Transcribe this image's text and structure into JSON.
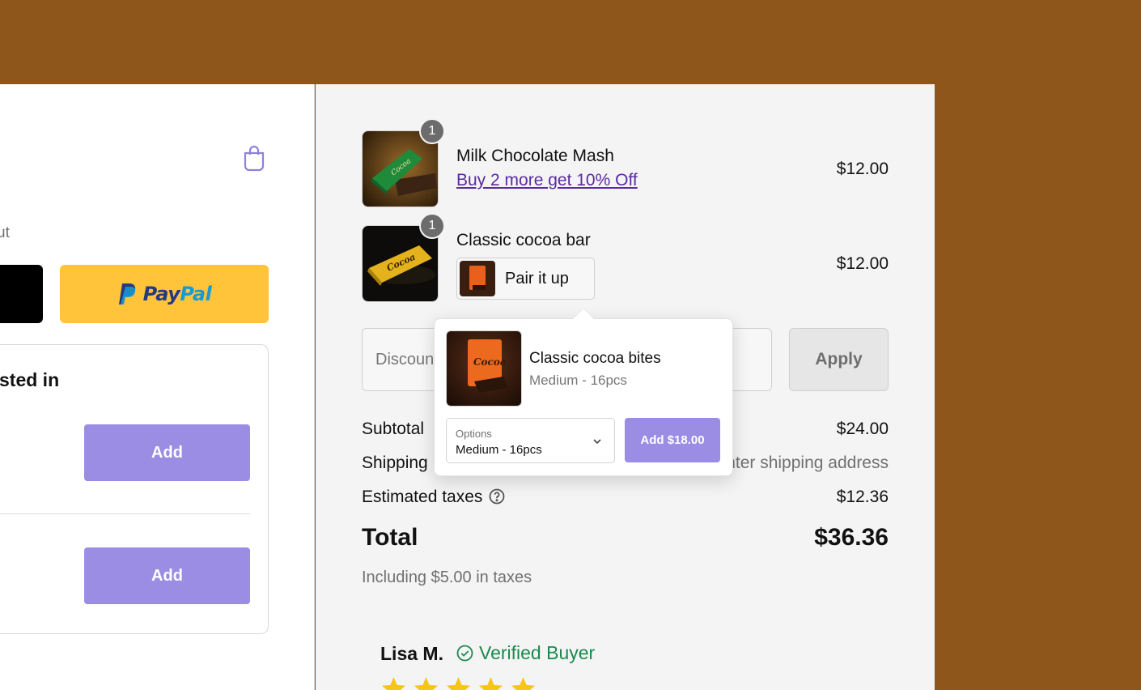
{
  "left": {
    "express_checkout_label": "ut",
    "paypal_label_pay": "Pay",
    "paypal_label_pal": "Pal",
    "upsell_heading": "sted in",
    "add_label_1": "Add",
    "add_label_2": "Add"
  },
  "cart": {
    "items": [
      {
        "name": "Milk Chocolate Mash",
        "price": "$12.00",
        "quantity": "1",
        "promo": "Buy 2 more get 10% Off"
      },
      {
        "name": "Classic cocoa bar",
        "price": "$12.00",
        "quantity": "1",
        "pair_label": "Pair it up"
      }
    ]
  },
  "discount": {
    "placeholder": "Discount code or gift card",
    "apply_label": "Apply"
  },
  "summary": {
    "subtotal_label": "Subtotal",
    "subtotal_value": "$24.00",
    "shipping_label": "Shipping",
    "shipping_value": "Enter shipping address",
    "taxes_label": "Estimated taxes",
    "taxes_value": "$12.36",
    "total_label": "Total",
    "total_value": "$36.36",
    "tax_note": "Including $5.00 in taxes"
  },
  "popover": {
    "product_name": "Classic cocoa bites",
    "variant": "Medium - 16pcs",
    "options_caption": "Options",
    "options_value": "Medium - 16pcs",
    "add_label": "Add $18.00"
  },
  "review": {
    "reviewer": "Lisa M.",
    "badge": "Verified Buyer",
    "rating": 5
  },
  "colors": {
    "frame": "#8e561a",
    "accent": "#9b8ce4",
    "link": "#5a2ba2",
    "paypal_yellow": "#ffc43a",
    "verified_green": "#1a8a4e",
    "star": "#f5c518"
  }
}
